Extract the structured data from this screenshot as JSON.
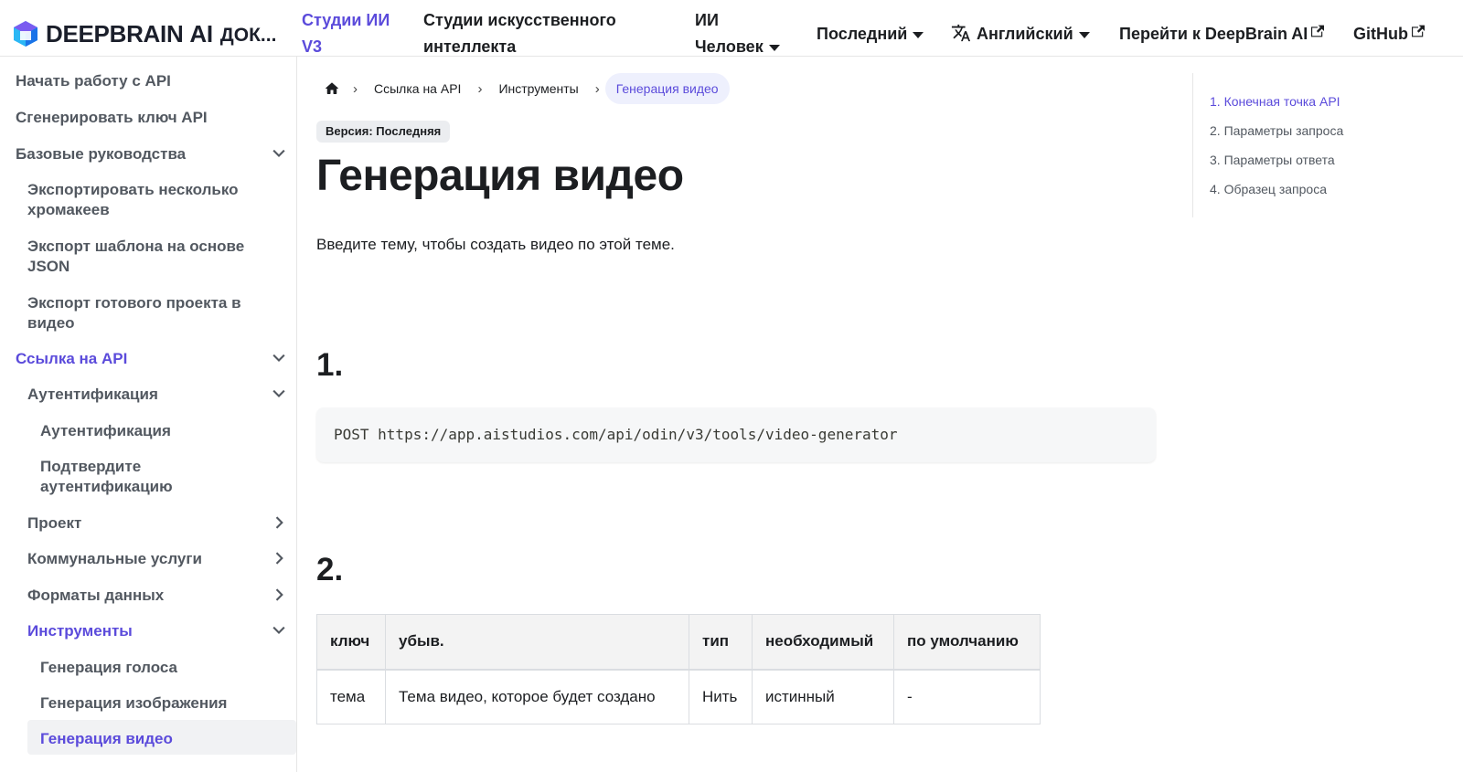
{
  "brand": {
    "name_main": "DEEPBRAIN",
    "name_ai": "AI",
    "docs": "ДОК...",
    "logo_colors": [
      "#2bb7f5",
      "#1a73e8",
      "#7b5cf0"
    ]
  },
  "navbar": {
    "link_studios_v3_line1": "Студии ИИ",
    "link_studios_v3_line2": "V3",
    "link_ai_studios_line1": "Студии искусственного",
    "link_ai_studios_line2": "интеллекта",
    "link_ai_human_line1": "ИИ",
    "link_ai_human_line2": "Человек",
    "version": "Последний",
    "language": "Английский",
    "goto": "Перейти к DeepBrain AI",
    "github": "GitHub"
  },
  "sidebar": {
    "items": [
      {
        "label": "Начать работу с API"
      },
      {
        "label": "Сгенерировать ключ API"
      },
      {
        "label": "Базовые руководства"
      },
      {
        "label_line1": "Экспортировать несколько",
        "label_line2": "хромакеев"
      },
      {
        "label_line1": "Экспорт шаблона на основе",
        "label_line2": "JSON"
      },
      {
        "label_line1": "Экспорт готового проекта в",
        "label_line2": "видео"
      },
      {
        "label": "Ссылка на API"
      },
      {
        "label": "Аутентификация"
      },
      {
        "label": "Аутентификация"
      },
      {
        "label_line1": "Подтвердите",
        "label_line2": "аутентификацию"
      },
      {
        "label": "Проект"
      },
      {
        "label": "Коммунальные услуги"
      },
      {
        "label": "Форматы данных"
      },
      {
        "label": "Инструменты"
      },
      {
        "label": "Генерация голоса"
      },
      {
        "label": "Генерация изображения"
      },
      {
        "label": "Генерация видео"
      }
    ]
  },
  "breadcrumbs": [
    "Ссылка на API",
    "Инструменты",
    "Генерация видео"
  ],
  "version_badge": "Версия: Последняя",
  "title": "Генерация видео",
  "lead": "Введите тему, чтобы создать видео по этой теме.",
  "section1": "1.",
  "code": "POST https://app.aistudios.com/api/odin/v3/tools/video-generator",
  "section2": "2.",
  "table": {
    "headers": [
      "ключ",
      "убыв.",
      "тип",
      "необходимый",
      "по умолчанию"
    ],
    "rows": [
      [
        "тема",
        "Тема видео, которое будет создано",
        "Нить",
        "истинный",
        "-"
      ]
    ]
  },
  "toc": [
    "1. Конечная точка API",
    "2. Параметры запроса",
    "3. Параметры ответа",
    "4. Образец запроса"
  ],
  "colors": {
    "accent": "#5b4bdb",
    "text": "#1c1e21",
    "muted": "#525860"
  }
}
